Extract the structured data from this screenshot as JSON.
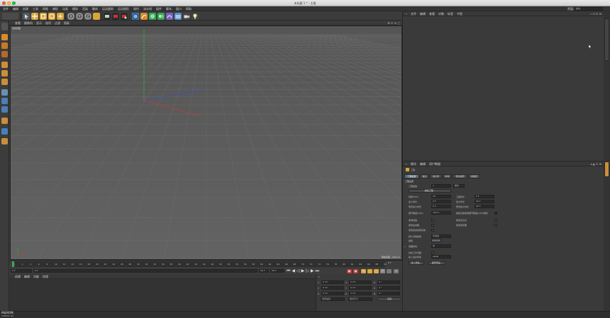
{
  "window": {
    "title": "未标题 1 * - 主要"
  },
  "menubar": {
    "items": [
      "文件",
      "编辑",
      "创建",
      "工具",
      "网格",
      "捕捉",
      "动画",
      "模拟",
      "渲染",
      "雕刻",
      "运动跟踪",
      "运动图形",
      "角色",
      "流水线",
      "插件",
      "脚本",
      "窗口",
      "帮助"
    ],
    "right_label": "界面:",
    "right_value": "启动"
  },
  "viewport": {
    "menu": [
      "查看",
      "摄像机",
      "显示",
      "选项",
      "过滤",
      "面板"
    ],
    "camera_label": "透视视图",
    "grid_spacing": "网格间距 : 100 cm"
  },
  "timeline": {
    "ticks": [
      "0",
      "2",
      "4",
      "6",
      "8",
      "10",
      "12",
      "14",
      "16",
      "18",
      "20",
      "22",
      "24",
      "26",
      "28",
      "30",
      "32",
      "34",
      "36",
      "38",
      "40",
      "42",
      "44",
      "46",
      "48",
      "50",
      "52",
      "54",
      "56",
      "58",
      "60",
      "62",
      "64",
      "66",
      "68",
      "70",
      "72",
      "74",
      "76",
      "78",
      "80",
      "82",
      "84",
      "86",
      "88",
      "90"
    ],
    "end_frame": "0 F",
    "start_field": "0 F",
    "current_field": "0 F",
    "end_field_a": "90 F",
    "end_field_b": "90 F"
  },
  "material": {
    "menu": [
      "创建",
      "编辑",
      "功能",
      "纹理"
    ]
  },
  "coordinates": {
    "rows": [
      {
        "a": "X",
        "av": "0 cm",
        "b": "X",
        "bv": "0 cm",
        "c": "H",
        "cv": "0 °"
      },
      {
        "a": "Y",
        "av": "0 cm",
        "b": "Y",
        "bv": "0 cm",
        "c": "P",
        "cv": "0 °"
      },
      {
        "a": "Z",
        "av": "0 cm",
        "b": "Z",
        "bv": "0 cm",
        "c": "B",
        "cv": "0 °"
      }
    ],
    "mode_a": "世界坐标",
    "mode_b": "绝对尺寸",
    "apply": "应用"
  },
  "objects": {
    "menu": [
      "文件",
      "编辑",
      "查看",
      "对象",
      "标签",
      "书签"
    ]
  },
  "attributes": {
    "menu": [
      "模式",
      "编辑",
      "用户数据"
    ],
    "header": "工程",
    "tabs": [
      "工程设置",
      "信息",
      "动力学",
      "参考",
      "待办事项",
      "帧插值"
    ],
    "section": "工程设置",
    "scale_label": "工程缩放",
    "scale_value": "1",
    "scale_unit": "厘米",
    "scale_button": "缩放工程...",
    "fps_label": "帧率(FPS)",
    "fps_value": "30",
    "project_time_label": "工程时长",
    "project_time_value": "0 F",
    "min_time_label": "最小时长",
    "min_time_value": "0 F",
    "max_time_label": "最大时长",
    "max_time_value": "90 F",
    "preview_min_label": "预览最小时长",
    "preview_min_value": "0 F",
    "preview_max_label": "预览最大时长",
    "preview_max_value": "90 F",
    "lod_label": "细节程度(LOD)",
    "lod_value": "100 %",
    "render_lod_label": "编辑渲染使用细节程度(LOD)级别",
    "use_anim_label": "使用动画",
    "use_expr_label": "使用表达式",
    "use_gen_label": "使用生成器",
    "use_deform_label": "使用变形器",
    "use_motion_label": "使用运动剪辑系统",
    "default_color_label": "默认对象颜色",
    "default_color_value": "灰蓝色",
    "color_label": "颜色",
    "view_clip_label": "视图修剪",
    "view_clip_value": "中",
    "linear_wf_label": "线性工作流程",
    "input_color_label": "输入色彩特性",
    "input_color_value": "sRGB",
    "load_preset": "载入预设...",
    "save_preset": "保存预设..."
  },
  "statusbar": {
    "brand_line1": "MAXON",
    "brand_line2": "CINEMA 4D"
  }
}
